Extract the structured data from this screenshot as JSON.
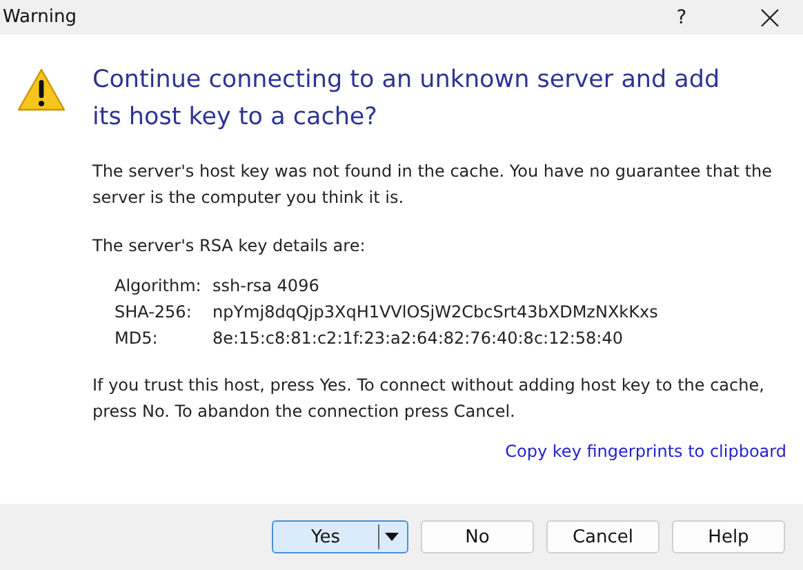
{
  "window": {
    "title": "Warning",
    "help_glyph": "?"
  },
  "heading": "Continue connecting to an unknown server and add its host key to a cache?",
  "message": "The server's host key was not found in the cache. You have no guarantee that the server is the computer you think it is.",
  "details_intro": "The server's RSA key details are:",
  "details": [
    {
      "label": "Algorithm:",
      "value": "ssh-rsa 4096"
    },
    {
      "label": "SHA-256:",
      "value": "npYmj8dqQjp3XqH1VVlOSjW2CbcSrt43bXDMzNXkKxs"
    },
    {
      "label": "MD5:",
      "value": "8e:15:c8:81:c2:1f:23:a2:64:82:76:40:8c:12:58:40"
    }
  ],
  "instructions": "If you trust this host, press Yes. To connect without adding host key to the cache, press No. To abandon the connection press Cancel.",
  "copy_link": "Copy key fingerprints to clipboard",
  "buttons": [
    {
      "label": "Yes",
      "kind": "split",
      "selected": true
    },
    {
      "label": "No",
      "kind": "plain",
      "selected": false
    },
    {
      "label": "Cancel",
      "kind": "plain",
      "selected": false
    },
    {
      "label": "Help",
      "kind": "plain",
      "selected": false
    }
  ]
}
